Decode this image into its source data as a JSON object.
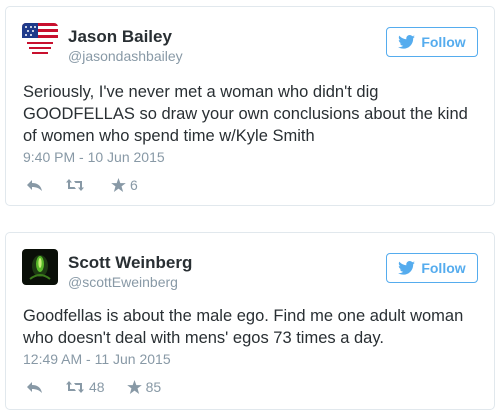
{
  "colors": {
    "accent": "#55acee",
    "text": "#292f33",
    "muted": "#8899a6",
    "border": "#e1e8ed"
  },
  "follow_icon": "twitter-bird-icon",
  "tweets": [
    {
      "display_name": "Jason Bailey",
      "handle": "@jasondashbailey",
      "avatar": "flag-avatar",
      "follow_label": "Follow",
      "text": "Seriously, I've never met a woman who didn't dig GOODFELLAS so draw your own conclusions about the kind of women who spend time w/Kyle Smith",
      "timestamp": "9:40 PM - 10 Jun 2015",
      "actions": {
        "reply_icon": "reply-icon",
        "retweet_icon": "retweet-icon",
        "retweet_count": "",
        "favorite_icon": "star-icon",
        "favorite_count": "6"
      }
    },
    {
      "display_name": "Scott Weinberg",
      "handle": "@scottEweinberg",
      "avatar": "alien-avatar",
      "follow_label": "Follow",
      "text": "Goodfellas is about the male ego. Find me one adult woman who doesn't deal with mens' egos 73 times a day.",
      "timestamp": "12:49 AM - 11 Jun 2015",
      "actions": {
        "reply_icon": "reply-icon",
        "retweet_icon": "retweet-icon",
        "retweet_count": "48",
        "favorite_icon": "star-icon",
        "favorite_count": "85"
      }
    }
  ]
}
